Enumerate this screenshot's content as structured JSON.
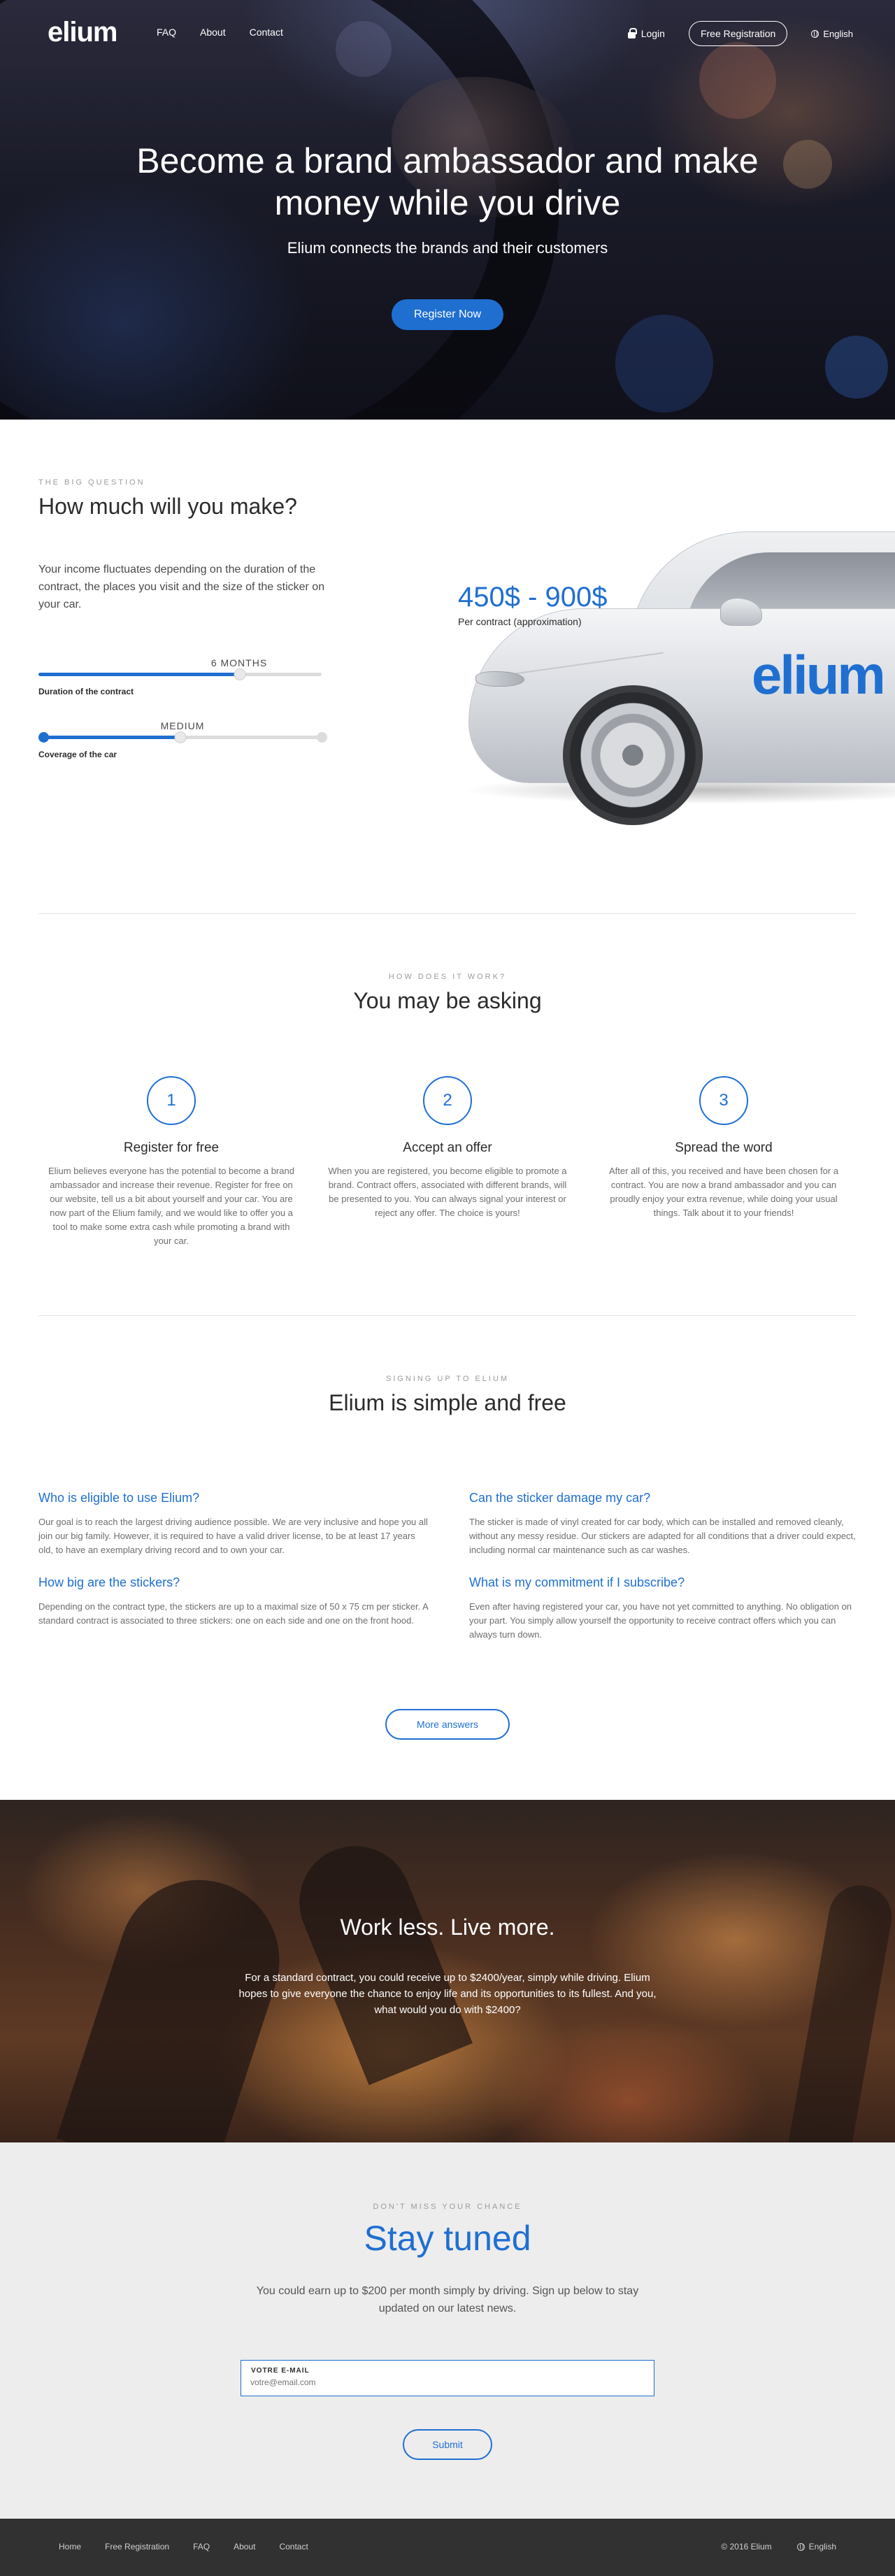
{
  "nav": {
    "logo": "elium",
    "links": [
      "FAQ",
      "About",
      "Contact"
    ],
    "login": "Login",
    "register": "Free Registration",
    "language": "English"
  },
  "hero": {
    "title": "Become a brand ambassador and make money while you drive",
    "subtitle": "Elium connects the brands and their customers",
    "cta": "Register Now"
  },
  "income": {
    "kicker": "THE BIG QUESTION",
    "title": "How much will you make?",
    "lead": "Your income fluctuates depending on the duration of the contract, the places you visit and the size of the sticker on your car.",
    "duration": {
      "value": "6 MONTHS",
      "label": "Duration of the contract",
      "level": 0.71
    },
    "coverage": {
      "value": "MEDIUM",
      "label": "Coverage of the car",
      "level": 0.5
    },
    "price": "450$ - 900$",
    "price_sub": "Per contract (approximation)",
    "car_logo": "elium"
  },
  "how": {
    "kicker": "HOW DOES IT WORK?",
    "title": "You may be asking",
    "steps": [
      {
        "num": "1",
        "title": "Register for free",
        "text": "Elium believes everyone has the potential to become a brand ambassador and increase their revenue. Register for free on our website, tell us a bit about yourself and your car. You are now part of the Elium family, and we would like to offer you a tool to make some extra cash while promoting a brand with your car."
      },
      {
        "num": "2",
        "title": "Accept an offer",
        "text": "When you are registered, you become eligible to promote a brand. Contract offers, associated with different brands, will be presented to you. You can always signal your interest or reject any offer. The choice is yours!"
      },
      {
        "num": "3",
        "title": "Spread the word",
        "text": "After all of this, you received and have been chosen for a contract. You are now a brand ambassador and you can proudly enjoy your extra revenue, while doing your usual things. Talk about it to your friends!"
      }
    ]
  },
  "faq": {
    "kicker": "SIGNING UP TO ELIUM",
    "title": "Elium is simple and free",
    "items": [
      {
        "q": "Who is eligible to use Elium?",
        "a": "Our goal is to reach the largest driving audience possible. We are very inclusive and hope you all join our big family. However, it is required to have a valid driver license, to be at least 17 years old, to have an exemplary driving record and to own your car."
      },
      {
        "q": "Can the sticker damage my car?",
        "a": "The sticker is made of vinyl created for car body, which can be installed and removed cleanly, without any messy residue. Our stickers are adapted for all conditions that a driver could expect, including normal car maintenance such as car washes."
      },
      {
        "q": "How big are the stickers?",
        "a": "Depending on the contract type, the stickers are up to a maximal size of 50 x 75 cm per sticker. A standard contract is associated to three stickers: one on each side and one on the front hood."
      },
      {
        "q": "What is my commitment if I subscribe?",
        "a": "Even after having registered your car, you have not yet committed to anything. No obligation on your part. You simply allow yourself the opportunity to receive contract offers which you can always turn down."
      }
    ],
    "more": "More answers"
  },
  "banner": {
    "title": "Work less. Live more.",
    "text": "For a standard contract, you could receive up to $2400/year, simply while driving. Elium hopes to give everyone the chance to enjoy life and its opportunities to its fullest. And you, what would you do with $2400?"
  },
  "signup": {
    "kicker": "DON'T MISS YOUR CHANCE",
    "title": "Stay tuned",
    "lead": "You could earn up to $200 per month simply by driving. Sign up below to stay updated on our latest news.",
    "email_label": "VOTRE E-MAIL",
    "email_placeholder": "votre@email.com",
    "submit": "Submit"
  },
  "footer": {
    "links": [
      "Home",
      "Free Registration",
      "FAQ",
      "About",
      "Contact"
    ],
    "copyright": "© 2016 Elium",
    "language": "English"
  },
  "colors": {
    "accent": "#1f6fd1",
    "footer": "#313131",
    "signup_bg": "#ededed"
  }
}
